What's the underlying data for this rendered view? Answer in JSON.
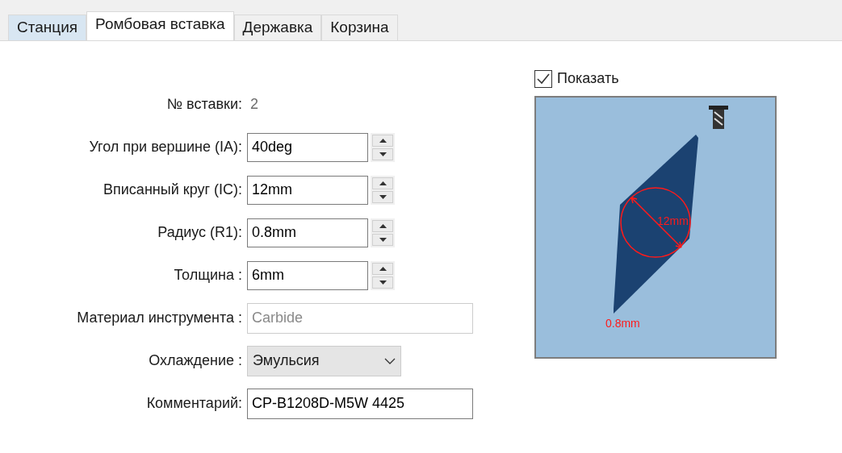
{
  "tabs": [
    {
      "label": "Станция",
      "selected": false,
      "hovered": true
    },
    {
      "label": "Ромбовая вставка",
      "selected": true,
      "hovered": false
    },
    {
      "label": "Державка",
      "selected": false,
      "hovered": false
    },
    {
      "label": "Корзина",
      "selected": false,
      "hovered": false
    }
  ],
  "fields": [
    {
      "kind": "value",
      "label": "№ вставки:",
      "value": "2"
    },
    {
      "kind": "spinner",
      "label": "Угол при вершине (IA):",
      "value": "40deg"
    },
    {
      "kind": "spinner",
      "label": "Вписанный круг (IC):",
      "value": "12mm"
    },
    {
      "kind": "spinner",
      "label": "Радиус (R1):",
      "value": "0.8mm"
    },
    {
      "kind": "spinner",
      "label": "Толщина :",
      "value": "6mm"
    },
    {
      "kind": "text",
      "label": "Материал инструмента :",
      "value": "Carbide",
      "disabled": true
    },
    {
      "kind": "dropdown",
      "label": "Охлаждение :",
      "value": "Эмульсия"
    },
    {
      "kind": "text",
      "label": "Комментарий:",
      "value": "CP-B1208D-M5W 4425",
      "disabled": false
    }
  ],
  "preview": {
    "show": {
      "label": "Показать",
      "checked": true
    },
    "diameter_label": "12mm",
    "radius_label": "0.8mm"
  }
}
